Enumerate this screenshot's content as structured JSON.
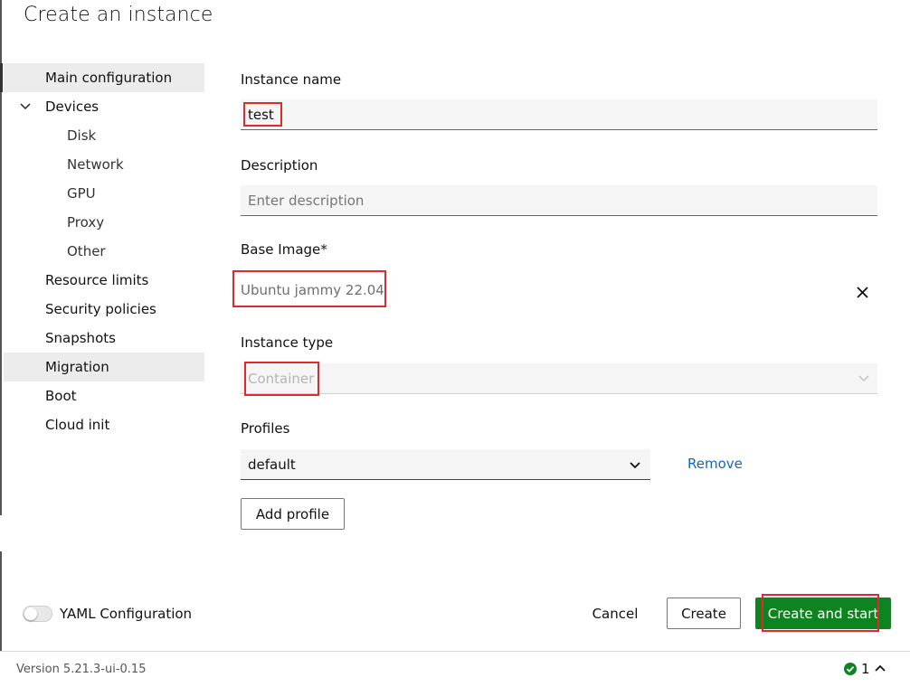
{
  "page": {
    "title": "Create an instance"
  },
  "sidebar": {
    "items": [
      {
        "label": "Main configuration"
      },
      {
        "label": "Devices"
      },
      {
        "label": "Disk"
      },
      {
        "label": "Network"
      },
      {
        "label": "GPU"
      },
      {
        "label": "Proxy"
      },
      {
        "label": "Other"
      },
      {
        "label": "Resource limits"
      },
      {
        "label": "Security policies"
      },
      {
        "label": "Snapshots"
      },
      {
        "label": "Migration"
      },
      {
        "label": "Boot"
      },
      {
        "label": "Cloud init"
      }
    ]
  },
  "form": {
    "instance_name": {
      "label": "Instance name",
      "value": "test"
    },
    "description": {
      "label": "Description",
      "placeholder": "Enter description"
    },
    "base_image": {
      "label": "Base Image*",
      "value": "Ubuntu jammy 22.04"
    },
    "instance_type": {
      "label": "Instance type",
      "value": "Container"
    },
    "profiles": {
      "label": "Profiles",
      "value": "default",
      "remove_label": "Remove",
      "add_label": "Add profile"
    }
  },
  "footer": {
    "yaml_toggle_label": "YAML Configuration",
    "cancel_label": "Cancel",
    "create_label": "Create",
    "create_start_label": "Create and start",
    "version": "Version 5.21.3-ui-0.15",
    "status_count": "1"
  },
  "colors": {
    "accent_link": "#0e66c4",
    "positive": "#0e8420",
    "highlight": "#e02a2a",
    "status_ok": "#0e8420"
  },
  "icons": {
    "expand": "chevron-down-icon",
    "clear": "close-icon",
    "status": "success-icon",
    "status_toggle": "chevron-up-icon"
  }
}
